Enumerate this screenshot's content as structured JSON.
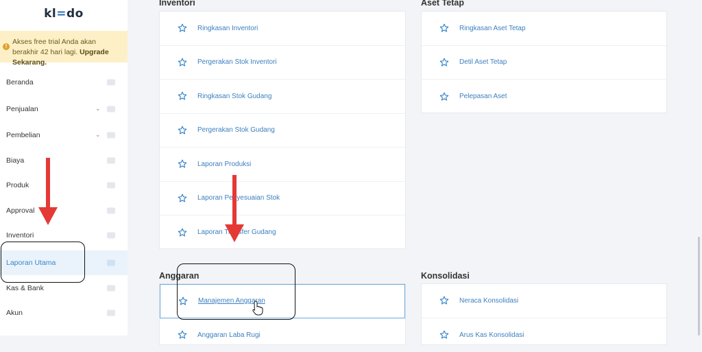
{
  "app": {
    "logo_prefix": "kl",
    "logo_accent": "=",
    "logo_suffix": "do"
  },
  "trial_banner": {
    "text": "Akses free trial Anda akan berakhir 42 hari lagi.",
    "cta": "Upgrade Sekarang."
  },
  "sidebar": {
    "items": [
      {
        "label": "Beranda",
        "icon": "home-icon",
        "has_chevron": false
      },
      {
        "label": "Penjualan",
        "icon": "basket-icon",
        "has_chevron": true
      },
      {
        "label": "Pembelian",
        "icon": "bag-icon",
        "has_chevron": true
      },
      {
        "label": "Biaya",
        "icon": "card-icon",
        "has_chevron": false
      },
      {
        "label": "Produk",
        "icon": "box-icon",
        "has_chevron": false
      },
      {
        "label": "Approval",
        "icon": "check-icon",
        "has_chevron": false
      },
      {
        "label": "Inventori",
        "icon": "warehouse-icon",
        "has_chevron": false
      },
      {
        "label": "Laporan Utama",
        "icon": "chart-icon",
        "has_chevron": false,
        "active": true
      },
      {
        "label": "Kas & Bank",
        "icon": "dollar-icon",
        "has_chevron": false
      },
      {
        "label": "Akun",
        "icon": "list-icon",
        "has_chevron": false
      }
    ]
  },
  "sections": {
    "inventori": {
      "title": "Inventori",
      "items": [
        "Ringkasan Inventori",
        "Pergerakan Stok Inventori",
        "Ringkasan Stok Gudang",
        "Pergerakan Stok Gudang",
        "Laporan Produksi",
        "Laporan Penyesuaian Stok",
        "Laporan Transfer Gudang"
      ]
    },
    "aset_tetap": {
      "title": "Aset Tetap",
      "items": [
        "Ringkasan Aset Tetap",
        "Detil Aset Tetap",
        "Pelepasan Aset"
      ]
    },
    "anggaran": {
      "title": "Anggaran",
      "items": [
        "Manajemen Anggaran",
        "Anggaran Laba Rugi"
      ]
    },
    "konsolidasi": {
      "title": "Konsolidasi",
      "items": [
        "Neraca Konsolidasi",
        "Arus Kas Konsolidasi"
      ]
    }
  },
  "colors": {
    "accent": "#3a86c8",
    "annotation_arrow": "#e53935",
    "trial_bg": "#fdf0c6"
  }
}
